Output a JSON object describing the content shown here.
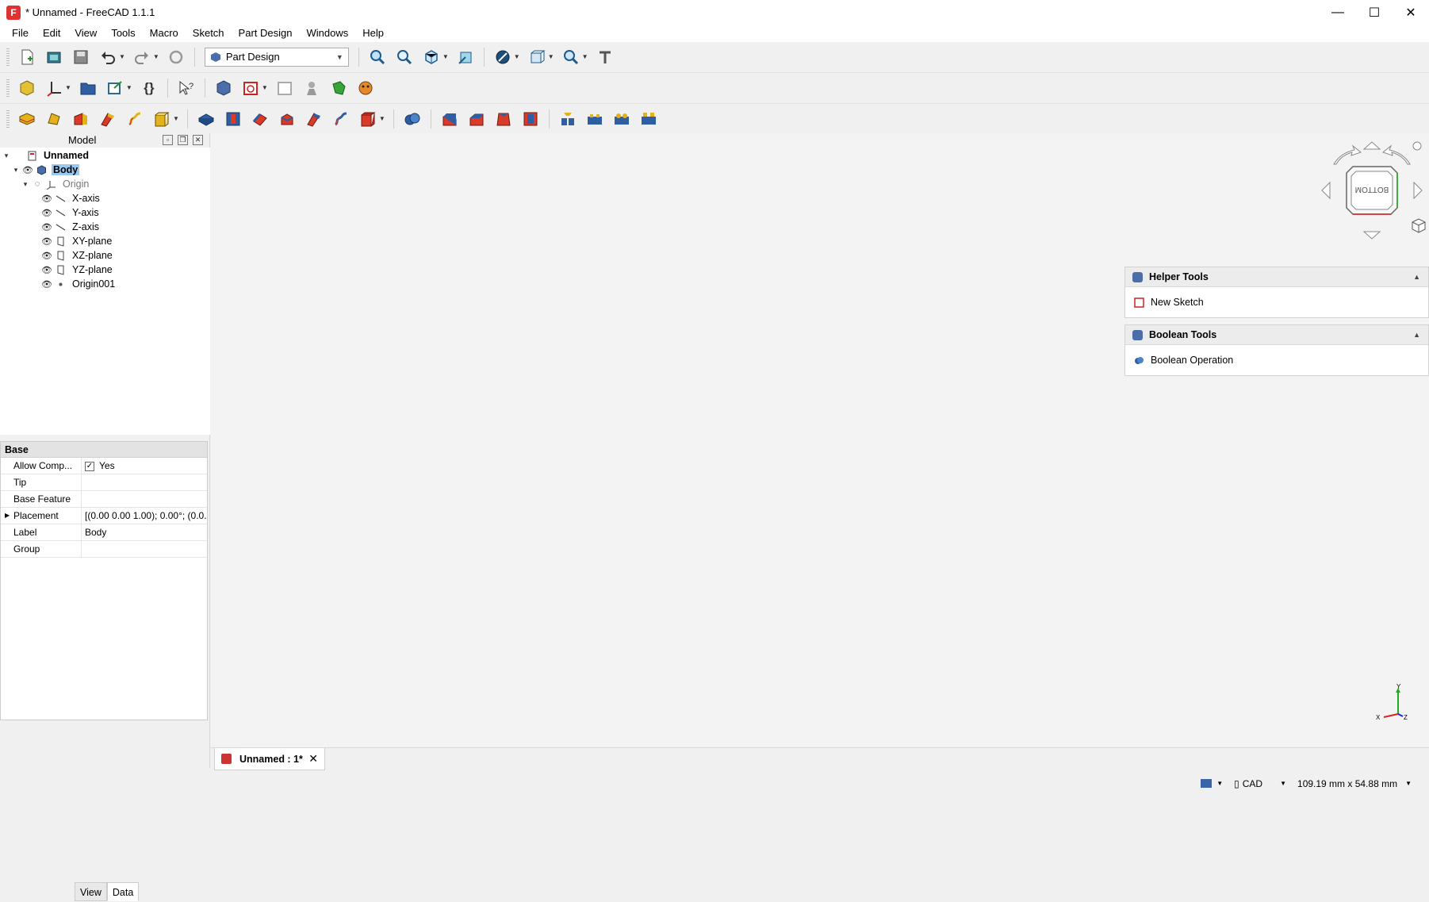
{
  "window": {
    "title": "* Unnamed - FreeCAD 1.1.1",
    "minimize": "—",
    "maximize": "☐",
    "close": "✕"
  },
  "menu": [
    "File",
    "Edit",
    "View",
    "Tools",
    "Macro",
    "Sketch",
    "Part Design",
    "Windows",
    "Help"
  ],
  "workbench": {
    "selected": "Part Design"
  },
  "model_panel": {
    "title": "Model"
  },
  "tree": [
    {
      "label": "Unnamed",
      "bold": true,
      "indent": 0,
      "expand": "▾",
      "eye": "",
      "icon": "document-icon"
    },
    {
      "label": "Body",
      "bold": true,
      "indent": 1,
      "expand": "▾",
      "eye": "👁",
      "icon": "body-icon",
      "selected": true
    },
    {
      "label": "Origin",
      "bold": false,
      "indent": 2,
      "expand": "▾",
      "eye": "◌",
      "icon": "origin-icon",
      "dim": true
    },
    {
      "label": "X-axis",
      "indent": 3,
      "eye": "👁",
      "icon": "axis-icon"
    },
    {
      "label": "Y-axis",
      "indent": 3,
      "eye": "👁",
      "icon": "axis-icon"
    },
    {
      "label": "Z-axis",
      "indent": 3,
      "eye": "👁",
      "icon": "axis-icon"
    },
    {
      "label": "XY-plane",
      "indent": 3,
      "eye": "👁",
      "icon": "plane-icon"
    },
    {
      "label": "XZ-plane",
      "indent": 3,
      "eye": "👁",
      "icon": "plane-icon"
    },
    {
      "label": "YZ-plane",
      "indent": 3,
      "eye": "👁",
      "icon": "plane-icon"
    },
    {
      "label": "Origin001",
      "indent": 3,
      "eye": "👁",
      "icon": "point-icon"
    }
  ],
  "properties": {
    "group": "Base",
    "rows": [
      {
        "name": "Allow Comp...",
        "value": "Yes",
        "checkbox": true
      },
      {
        "name": "Tip",
        "value": ""
      },
      {
        "name": "Base Feature",
        "value": ""
      },
      {
        "name": "Placement",
        "value": "[(0.00 0.00 1.00); 0.00°; (0.0...",
        "expandable": true
      },
      {
        "name": "Label",
        "value": "Body"
      },
      {
        "name": "Group",
        "value": ""
      }
    ]
  },
  "bottom_tabs": [
    "View",
    "Data"
  ],
  "task_panels": [
    {
      "title": "Helper Tools",
      "item": "New Sketch"
    },
    {
      "title": "Boolean Tools",
      "item": "Boolean Operation"
    }
  ],
  "navcube": {
    "face": "BOTTOM"
  },
  "axes": {
    "y": "Y",
    "x": "X",
    "z": "Z"
  },
  "doc_tab": {
    "label": "Unnamed : 1*"
  },
  "status": {
    "nav_style": "CAD",
    "dimensions": "109.19 mm x 54.88 mm"
  },
  "colors": {
    "selection": "#99c9ef",
    "accent": "#3b64a8"
  }
}
